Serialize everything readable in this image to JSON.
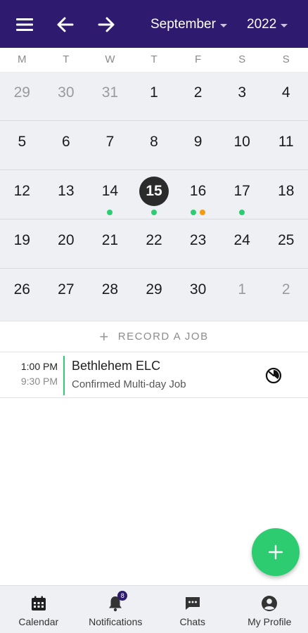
{
  "header": {
    "month": "September",
    "year": "2022"
  },
  "weekdays": [
    "M",
    "T",
    "W",
    "T",
    "F",
    "S",
    "S"
  ],
  "weeks": [
    [
      {
        "d": "29",
        "muted": true
      },
      {
        "d": "30",
        "muted": true
      },
      {
        "d": "31",
        "muted": true
      },
      {
        "d": "1"
      },
      {
        "d": "2"
      },
      {
        "d": "3"
      },
      {
        "d": "4"
      }
    ],
    [
      {
        "d": "5"
      },
      {
        "d": "6"
      },
      {
        "d": "7"
      },
      {
        "d": "8"
      },
      {
        "d": "9"
      },
      {
        "d": "10"
      },
      {
        "d": "11"
      }
    ],
    [
      {
        "d": "12"
      },
      {
        "d": "13"
      },
      {
        "d": "14",
        "dots": [
          "#2ecc71"
        ]
      },
      {
        "d": "15",
        "selected": true,
        "dots": [
          "#2ecc71"
        ]
      },
      {
        "d": "16",
        "dots": [
          "#2ecc71",
          "#f39c12"
        ]
      },
      {
        "d": "17",
        "dots": [
          "#2ecc71"
        ]
      },
      {
        "d": "18"
      }
    ],
    [
      {
        "d": "19"
      },
      {
        "d": "20"
      },
      {
        "d": "21"
      },
      {
        "d": "22"
      },
      {
        "d": "23"
      },
      {
        "d": "24"
      },
      {
        "d": "25"
      }
    ],
    [
      {
        "d": "26"
      },
      {
        "d": "27"
      },
      {
        "d": "28"
      },
      {
        "d": "29"
      },
      {
        "d": "30"
      },
      {
        "d": "1",
        "muted": true
      },
      {
        "d": "2",
        "muted": true
      }
    ]
  ],
  "record": {
    "label": "RECORD A JOB"
  },
  "job": {
    "start": "1:00 PM",
    "end": "9:30 PM",
    "title": "Bethlehem ELC",
    "subtitle": "Confirmed Multi-day Job"
  },
  "nav": {
    "calendar": "Calendar",
    "notifications": "Notifications",
    "notifications_badge": "8",
    "chats": "Chats",
    "profile": "My Profile"
  },
  "colors": {
    "header_bg": "#2e1a6e",
    "accent_green": "#2ecc71",
    "accent_orange": "#f39c12"
  }
}
